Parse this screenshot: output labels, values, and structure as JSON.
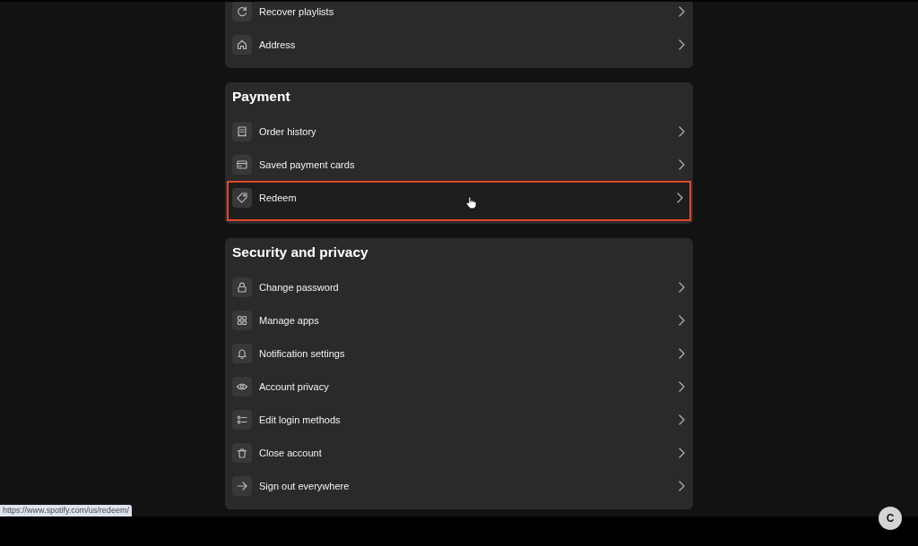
{
  "sections": [
    {
      "items": [
        {
          "label": "Recover playlists",
          "highlighted": false
        },
        {
          "label": "Address",
          "highlighted": false
        }
      ]
    },
    {
      "title": "Payment",
      "items": [
        {
          "label": "Order history",
          "highlighted": false
        },
        {
          "label": "Saved payment cards",
          "highlighted": false
        },
        {
          "label": "Redeem",
          "highlighted": true
        }
      ]
    },
    {
      "title": "Security and privacy",
      "items": [
        {
          "label": "Change password",
          "highlighted": false
        },
        {
          "label": "Manage apps",
          "highlighted": false
        },
        {
          "label": "Notification settings",
          "highlighted": false
        },
        {
          "label": "Account privacy",
          "highlighted": false
        },
        {
          "label": "Edit login methods",
          "highlighted": false
        },
        {
          "label": "Close account",
          "highlighted": false
        },
        {
          "label": "Sign out everywhere",
          "highlighted": false
        }
      ]
    }
  ],
  "status_url": "https://www.spotify.com/us/redeem/",
  "avatar": {
    "initial": "C"
  }
}
